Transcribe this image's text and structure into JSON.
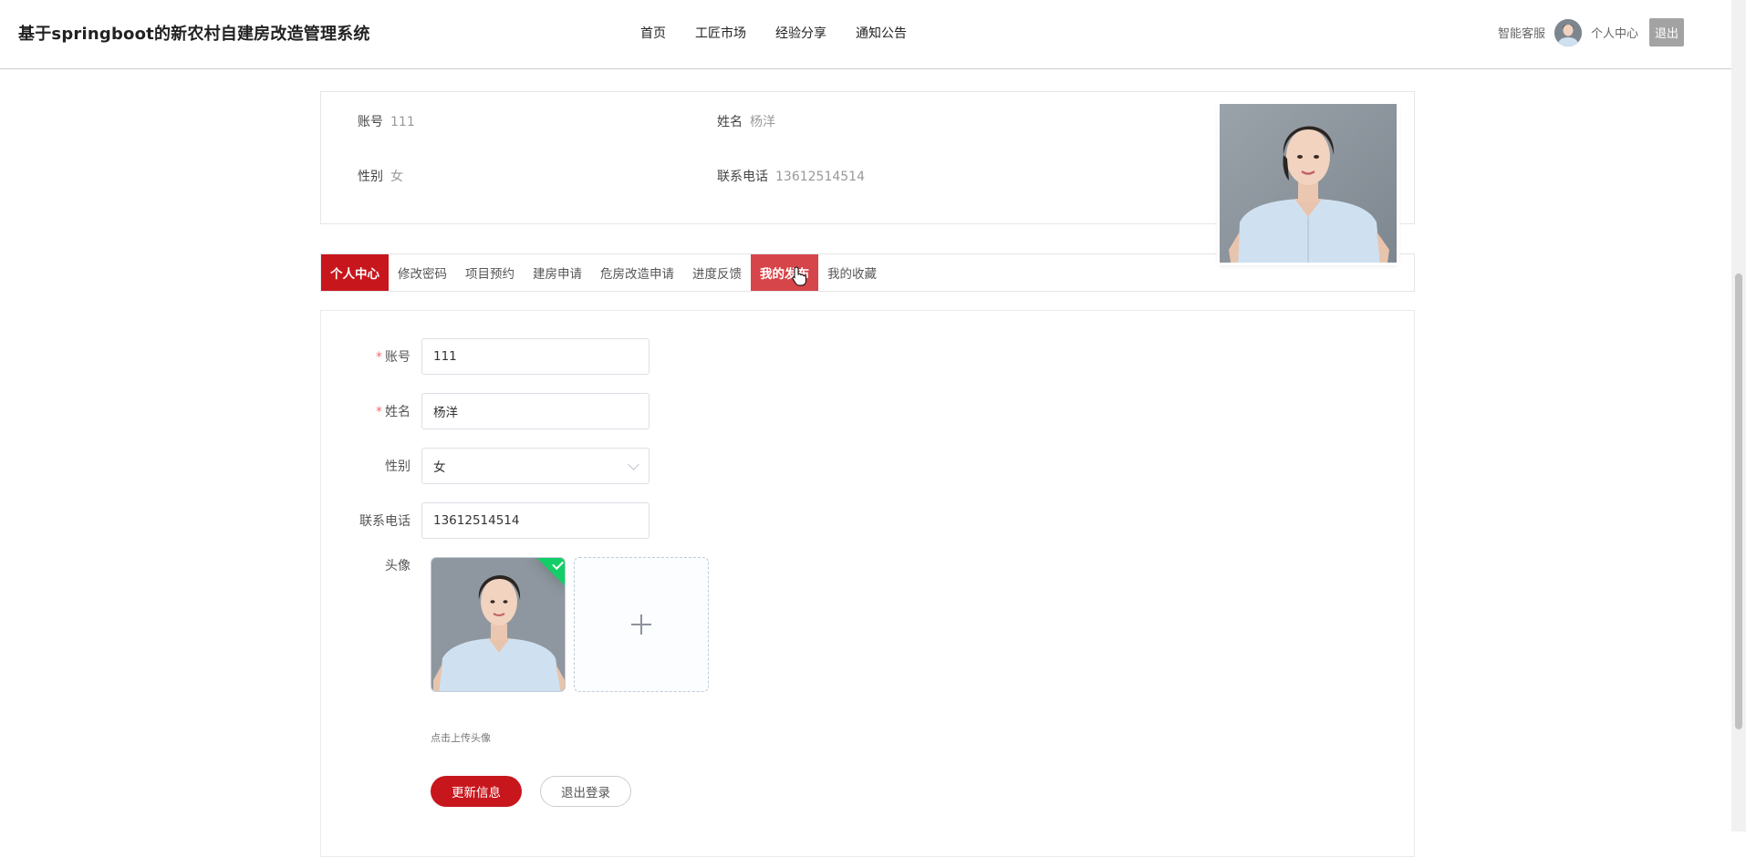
{
  "header": {
    "title": "基于springboot的新农村自建房改造管理系统",
    "nav": [
      "首页",
      "工匠市场",
      "经验分享",
      "通知公告"
    ],
    "service_label": "智能客服",
    "user_center_label": "个人中心",
    "logout_label": "退出"
  },
  "profile_summary": {
    "account_label": "账号",
    "account_value": "111",
    "name_label": "姓名",
    "name_value": "杨洋",
    "gender_label": "性别",
    "gender_value": "女",
    "phone_label": "联系电话",
    "phone_value": "13612514514"
  },
  "tabs": [
    {
      "label": "个人中心",
      "state": "active"
    },
    {
      "label": "修改密码",
      "state": "normal"
    },
    {
      "label": "项目预约",
      "state": "normal"
    },
    {
      "label": "建房申请",
      "state": "normal"
    },
    {
      "label": "危房改造申请",
      "state": "normal"
    },
    {
      "label": "进度反馈",
      "state": "normal"
    },
    {
      "label": "我的发布",
      "state": "hover"
    },
    {
      "label": "我的收藏",
      "state": "normal"
    }
  ],
  "form": {
    "required_mark": "*",
    "account_label": "账号",
    "account_value": "111",
    "name_label": "姓名",
    "name_value": "杨洋",
    "gender_label": "性别",
    "gender_value": "女",
    "phone_label": "联系电话",
    "phone_value": "13612514514",
    "avatar_label": "头像",
    "upload_hint": "点击上传头像",
    "update_button": "更新信息",
    "logout_button": "退出登录"
  },
  "colors": {
    "accent": "#c8161d",
    "tab_hover": "#d6454a",
    "success": "#13ce66",
    "required": "#f56c6c"
  }
}
